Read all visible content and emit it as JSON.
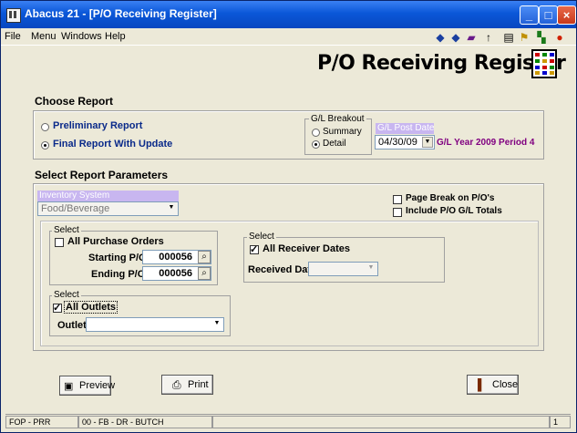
{
  "window": {
    "title": "Abacus 21 - [P/O Receiving Register]"
  },
  "menu": [
    "File",
    "Menu",
    "Windows",
    "Help"
  ],
  "toolbar": {
    "icons": [
      "arrow-left-icon",
      "arrow-right-icon",
      "book-icon",
      "pointer-icon",
      "calculator-icon",
      "runner-icon",
      "exit-door-icon",
      "stop-icon"
    ]
  },
  "page_title": "P/O Receiving Register",
  "choose_report": {
    "heading": "Choose Report",
    "options": [
      "Preliminary Report",
      "Final Report With Update"
    ],
    "selected": "Final Report With Update",
    "gl_breakout": {
      "caption": "G/L Breakout",
      "options": [
        "Summary",
        "Detail"
      ],
      "selected": "Detail"
    },
    "gl_post_date": {
      "label": "G/L Post Date",
      "value": "04/30/09",
      "period_text": "G/L Year 2009 Period 4"
    }
  },
  "params": {
    "heading": "Select Report Parameters",
    "inventory_system": {
      "label": "Inventory System",
      "value": "Food/Beverage"
    },
    "page_break": {
      "label": "Page Break on P/O's",
      "checked": false
    },
    "include_gl": {
      "label": "Include P/O G/L Totals",
      "checked": false
    },
    "po_group": {
      "caption": "Select",
      "all_label": "All Purchase Orders",
      "all_checked": false,
      "start_label": "Starting P/O",
      "start_value": "000056",
      "end_label": "Ending P/O",
      "end_value": "000056"
    },
    "outlet_group": {
      "caption": "Select",
      "all_label": "All Outlets",
      "all_checked": true,
      "outlet_label": "Outlet",
      "outlet_value": ""
    },
    "receiver_group": {
      "caption": "Select",
      "all_label": "All Receiver Dates",
      "all_checked": true,
      "date_label": "Received Date",
      "date_value": ""
    }
  },
  "buttons": {
    "preview": "Preview",
    "print": "Print",
    "close": "Close"
  },
  "status": {
    "cell1": "FOP - PRR",
    "cell2": "00 - FB - DR - BUTCH",
    "cell3": "",
    "cell4": "1"
  },
  "colors": {
    "titlebar": "#0a57d8",
    "gl_label_bg": "#c8b6f0",
    "period_text": "#800080",
    "inv_label_bg": "#c8b6f0"
  }
}
